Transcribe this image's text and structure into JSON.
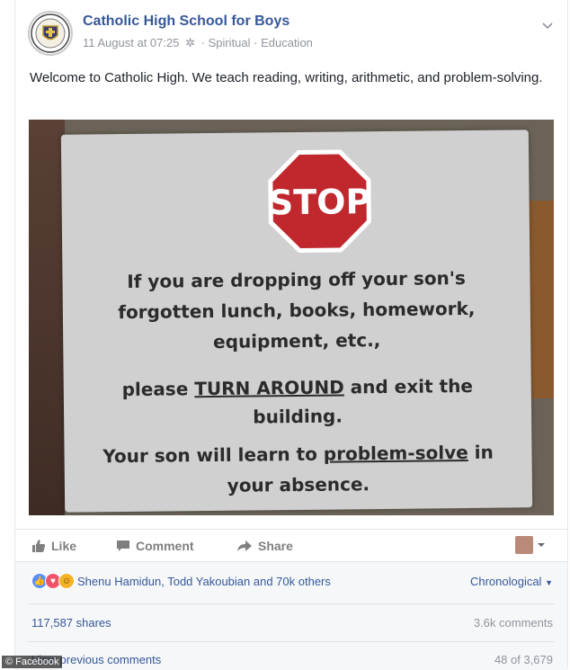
{
  "post": {
    "page_name": "Catholic High School for Boys",
    "date": "11 August at 07:25",
    "tags": "· Spiritual · Education",
    "caption": "Welcome to Catholic High. We teach reading, writing, arithmetic, and problem-solving."
  },
  "sign": {
    "stop": "STOP",
    "line1": "If you are dropping off your son's",
    "line2": "forgotten lunch, books, homework,",
    "line3": "equipment, etc.,",
    "line4a": "please ",
    "line4b": "TURN AROUND",
    "line4c": " and exit the",
    "line5": "building.",
    "line6a": "Your son will learn to ",
    "line6b": "problem-solve",
    "line6c": " in",
    "line7": "your absence."
  },
  "actions": {
    "like": "Like",
    "comment": "Comment",
    "share": "Share"
  },
  "reactions": {
    "names": "Shenu Hamidun, Todd Yakoubian and 70k others",
    "sort": "Chronological",
    "shares": "117,587 shares",
    "comments": "3.6k comments",
    "previous": "View previous comments",
    "count": "48 of 3,679"
  },
  "watermark": "© Facebook",
  "colors": {
    "link": "#365899",
    "stop": "#c0282d",
    "like": "#5890ff",
    "love": "#f25268",
    "haha": "#f7b125"
  }
}
